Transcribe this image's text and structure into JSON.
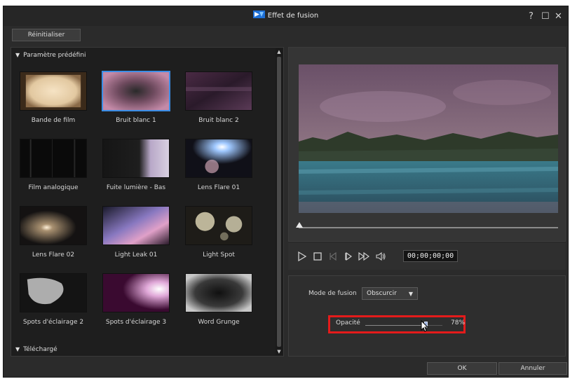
{
  "window": {
    "title": "Effet de fusion",
    "help": "?",
    "maximize": "☐",
    "close": "✕"
  },
  "toolbar": {
    "reset_label": "Réinitialiser"
  },
  "presets": {
    "group_label": "Paramètre prédéfini",
    "downloaded_label": "Téléchargé",
    "items": [
      {
        "label": "Bande de film",
        "selected": false
      },
      {
        "label": "Bruit blanc 1",
        "selected": true
      },
      {
        "label": "Bruit blanc 2",
        "selected": false
      },
      {
        "label": "Film analogique",
        "selected": false
      },
      {
        "label": "Fuite lumière - Bas",
        "selected": false
      },
      {
        "label": "Lens Flare 01",
        "selected": false
      },
      {
        "label": "Lens Flare 02",
        "selected": false
      },
      {
        "label": "Light Leak 01",
        "selected": false
      },
      {
        "label": "Light Spot",
        "selected": false
      },
      {
        "label": "Spots d'éclairage 2",
        "selected": false
      },
      {
        "label": "Spots d'éclairage 3",
        "selected": false
      },
      {
        "label": "Word Grunge",
        "selected": false
      }
    ]
  },
  "player": {
    "timecode": "00;00;00;00",
    "playhead_fraction": 0
  },
  "settings": {
    "mode_label": "Mode de fusion",
    "mode_value": "Obscurcir",
    "opacity_label": "Opacité",
    "opacity_value": "78%",
    "opacity_fraction": 0.78
  },
  "footer": {
    "ok_label": "OK",
    "cancel_label": "Annuler"
  },
  "colors": {
    "accent": "#3a8ee6",
    "highlight": "#e41b1b"
  }
}
